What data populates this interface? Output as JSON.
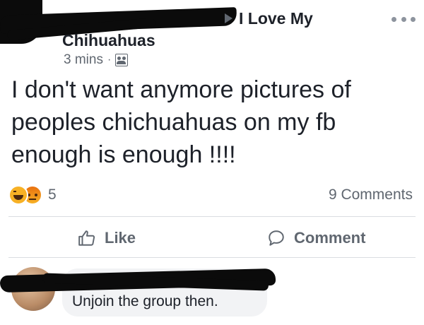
{
  "post": {
    "group_name_line1": "I Love My",
    "group_name_line2": "Chihuahuas",
    "timestamp": "3 mins",
    "separator": "·",
    "privacy_icon": "group-members-icon",
    "more_icon": "more-options-icon",
    "body": "I don't want anymore pictures of\npeoples chichuahuas on my fb\nenough is enough !!!!"
  },
  "reactions": {
    "icons": [
      "haha-reaction-icon",
      "angry-reaction-icon"
    ],
    "count": "5",
    "comments_count": "9 Comments"
  },
  "actions": {
    "like_label": "Like",
    "comment_label": "Comment"
  },
  "comment": {
    "text": "Unjoin the group then."
  },
  "colors": {
    "text_primary": "#1d2129",
    "text_secondary": "#606770",
    "divider": "#dadde1",
    "bubble": "#f2f3f5",
    "redaction": "#0b0b0b"
  }
}
